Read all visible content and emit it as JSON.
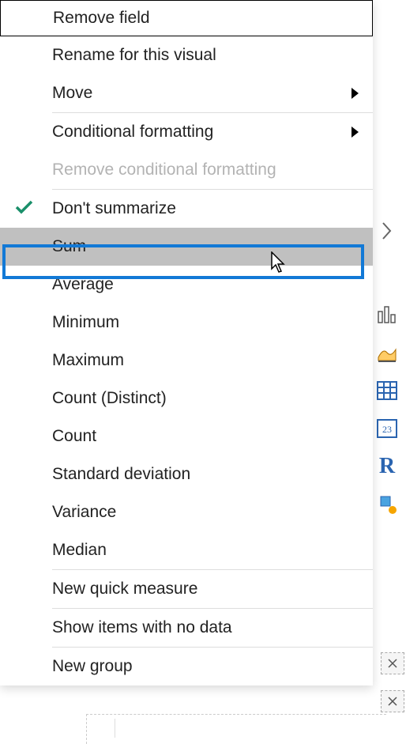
{
  "menu": {
    "remove_field": "Remove field",
    "rename": "Rename for this visual",
    "move": "Move",
    "cond_format": "Conditional formatting",
    "remove_cond": "Remove conditional formatting",
    "dont_sum": "Don't summarize",
    "sum": "Sum",
    "average": "Average",
    "minimum": "Minimum",
    "maximum": "Maximum",
    "count_distinct": "Count (Distinct)",
    "count": "Count",
    "std_dev": "Standard deviation",
    "variance": "Variance",
    "median": "Median",
    "quick_measure": "New quick measure",
    "show_items": "Show items with no data",
    "new_group": "New group"
  },
  "side": {
    "expand": "chevron-right",
    "viz_bar": "bar-chart",
    "viz_ribbon": "ribbon-chart",
    "viz_table": "table",
    "viz_card": "card-23",
    "viz_r": "R",
    "viz_key": "key-influencers"
  }
}
